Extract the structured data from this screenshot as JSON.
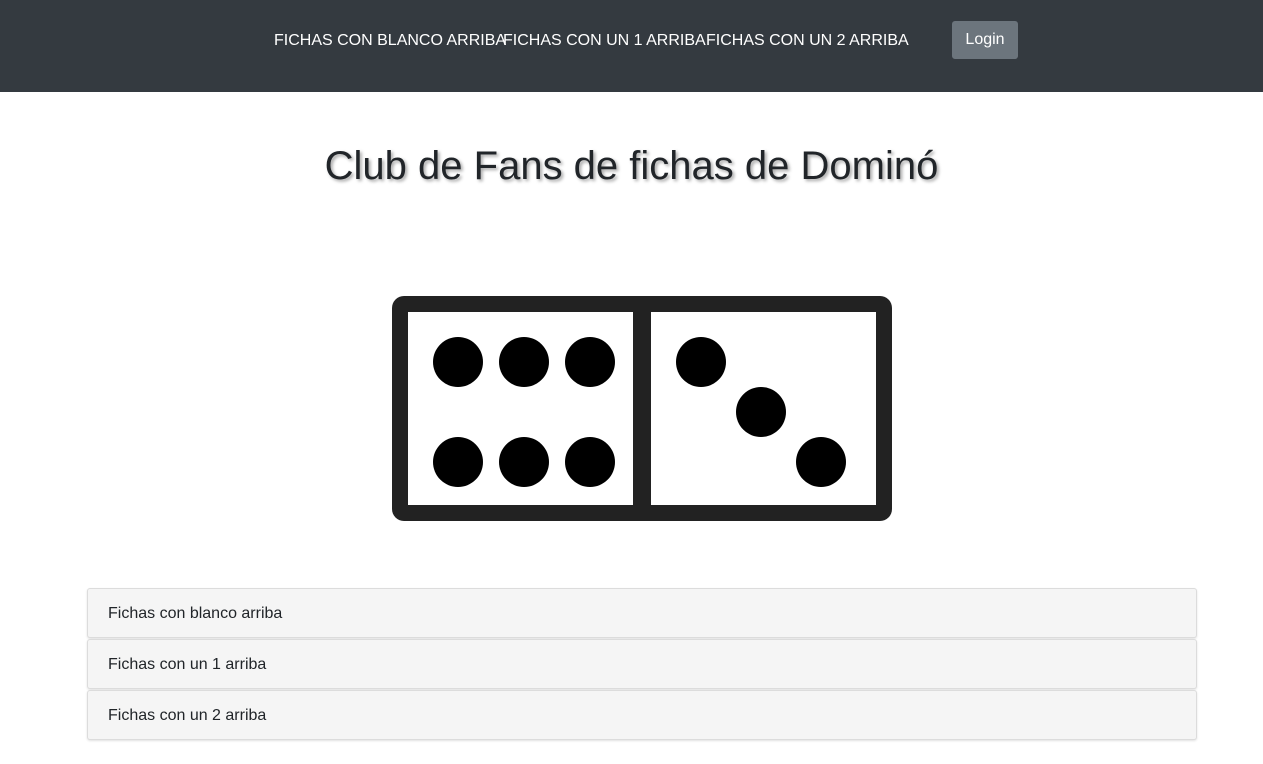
{
  "navbar": {
    "links": [
      {
        "label": "FICHAS CON BLANCO ARRIBA"
      },
      {
        "label": "FICHAS CON UN 1 ARRIBA"
      },
      {
        "label": "FICHAS CON UN 2 ARRIBA"
      }
    ],
    "login_label": "Login"
  },
  "main": {
    "title": "Club de Fans de fichas de Dominó",
    "domino": {
      "left_pips": 6,
      "right_pips": 3
    },
    "accordion": [
      {
        "label": "Fichas con blanco arriba"
      },
      {
        "label": "Fichas con un 1 arriba"
      },
      {
        "label": "Fichas con un 2 arriba"
      }
    ]
  },
  "colors": {
    "navbar_bg": "#343a40",
    "login_bg": "#6c757d",
    "domino_frame": "#222222",
    "pip": "#000000",
    "accordion_bg": "#f5f5f5"
  }
}
